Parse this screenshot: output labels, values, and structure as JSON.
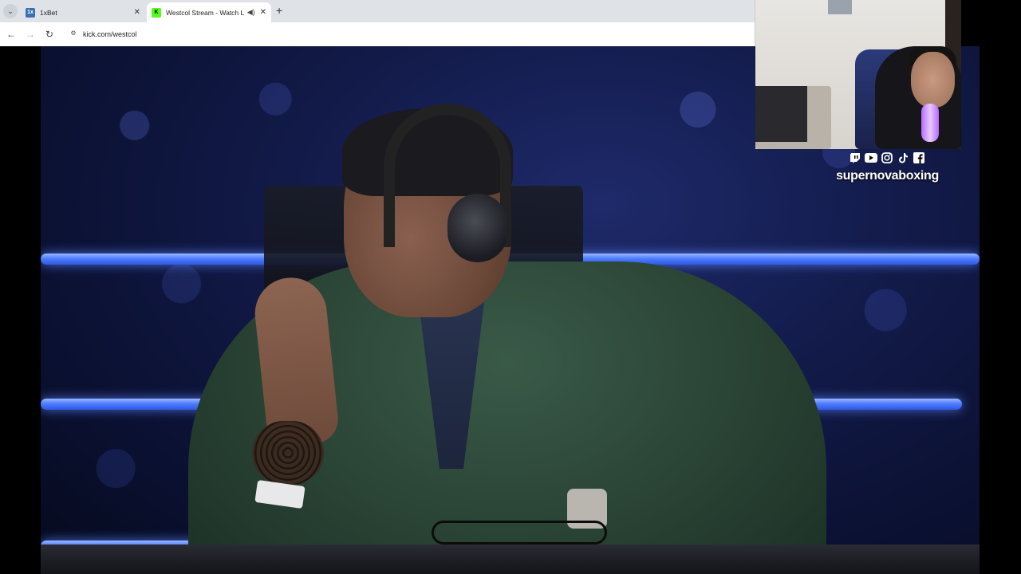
{
  "browser": {
    "tabs": [
      {
        "title": "1xBet",
        "favicon": "1x",
        "active": false
      },
      {
        "title": "Westcol Stream - Watch Liv",
        "favicon": "K",
        "active": true
      }
    ],
    "url": "kick.com/westcol"
  },
  "icons": {
    "tab_search": "chevron-down-icon",
    "back": "←",
    "forward": "→",
    "reload": "↻",
    "site_info": "⚙",
    "close": "✕",
    "new_tab": "+",
    "audio": "🔊"
  },
  "overlay": {
    "socials": [
      "twitch",
      "youtube",
      "instagram",
      "tiktok",
      "facebook"
    ],
    "channel_name": "supernovaboxing"
  },
  "colors": {
    "kick_green": "#53fc18",
    "rope_blue": "#4f7dff",
    "mic_purple": "#b56cff"
  }
}
